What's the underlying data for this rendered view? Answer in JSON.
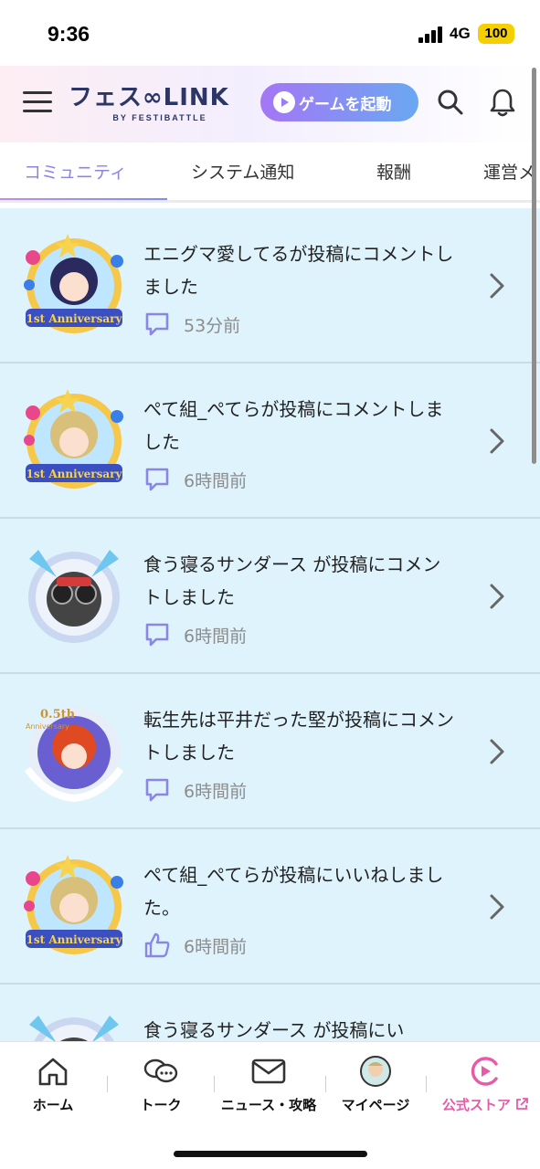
{
  "status_bar": {
    "time": "9:36",
    "network": "4G",
    "battery": "100",
    "battery_color": "#f5d000"
  },
  "header": {
    "logo_text": "フェス∞LINK",
    "logo_subtext": "BY FESTIBATTLE",
    "launch_button_label": "ゲームを起動",
    "menu_icon": "hamburger-icon",
    "search_icon": "search-icon",
    "bell_icon": "bell-icon"
  },
  "tabs": [
    {
      "label": "コミュニティ",
      "active": true
    },
    {
      "label": "システム通知",
      "active": false
    },
    {
      "label": "報酬",
      "active": false
    },
    {
      "label": "運営メ",
      "active": false
    }
  ],
  "notifications": [
    {
      "text": "エニグマ愛してるが投稿にコメントしました",
      "time": "53分前",
      "type": "comment",
      "avatar_badge": "1st Anniversary",
      "avatar_hair": "#2a2a5e"
    },
    {
      "text": "ぺて組_ぺてらが投稿にコメントしました",
      "time": "6時間前",
      "type": "comment",
      "avatar_badge": "1st Anniversary",
      "avatar_hair": "#d9c07a"
    },
    {
      "text": "食う寝るサンダース が投稿にコメントしました",
      "time": "6時間前",
      "type": "comment",
      "avatar_badge": "",
      "avatar_hair": "#444444"
    },
    {
      "text": "転生先は平井だった堅が投稿にコメントしました",
      "time": "6時間前",
      "type": "comment",
      "avatar_badge": "0.5th Anniversary",
      "avatar_hair": "#e04a22"
    },
    {
      "text": "ぺて組_ぺてらが投稿にいいねしました。",
      "time": "6時間前",
      "type": "like",
      "avatar_badge": "1st Anniversary",
      "avatar_hair": "#d9c07a"
    },
    {
      "text": "食う寝るサンダース が投稿にい",
      "time": "",
      "type": "comment",
      "avatar_badge": "",
      "avatar_hair": "#444444"
    }
  ],
  "bottom_nav": [
    {
      "label": "ホーム",
      "icon": "home-icon"
    },
    {
      "label": "トーク",
      "icon": "chat-icon"
    },
    {
      "label": "ニュース・攻略",
      "icon": "mail-icon"
    },
    {
      "label": "マイページ",
      "icon": "avatar-icon"
    },
    {
      "label": "公式ストア",
      "icon": "store-icon",
      "accent": "#e85aa8"
    }
  ],
  "colors": {
    "list_bg": "#dff3fc",
    "accent_purple": "#8a86e6",
    "meta_icon": "#8a86e6"
  }
}
